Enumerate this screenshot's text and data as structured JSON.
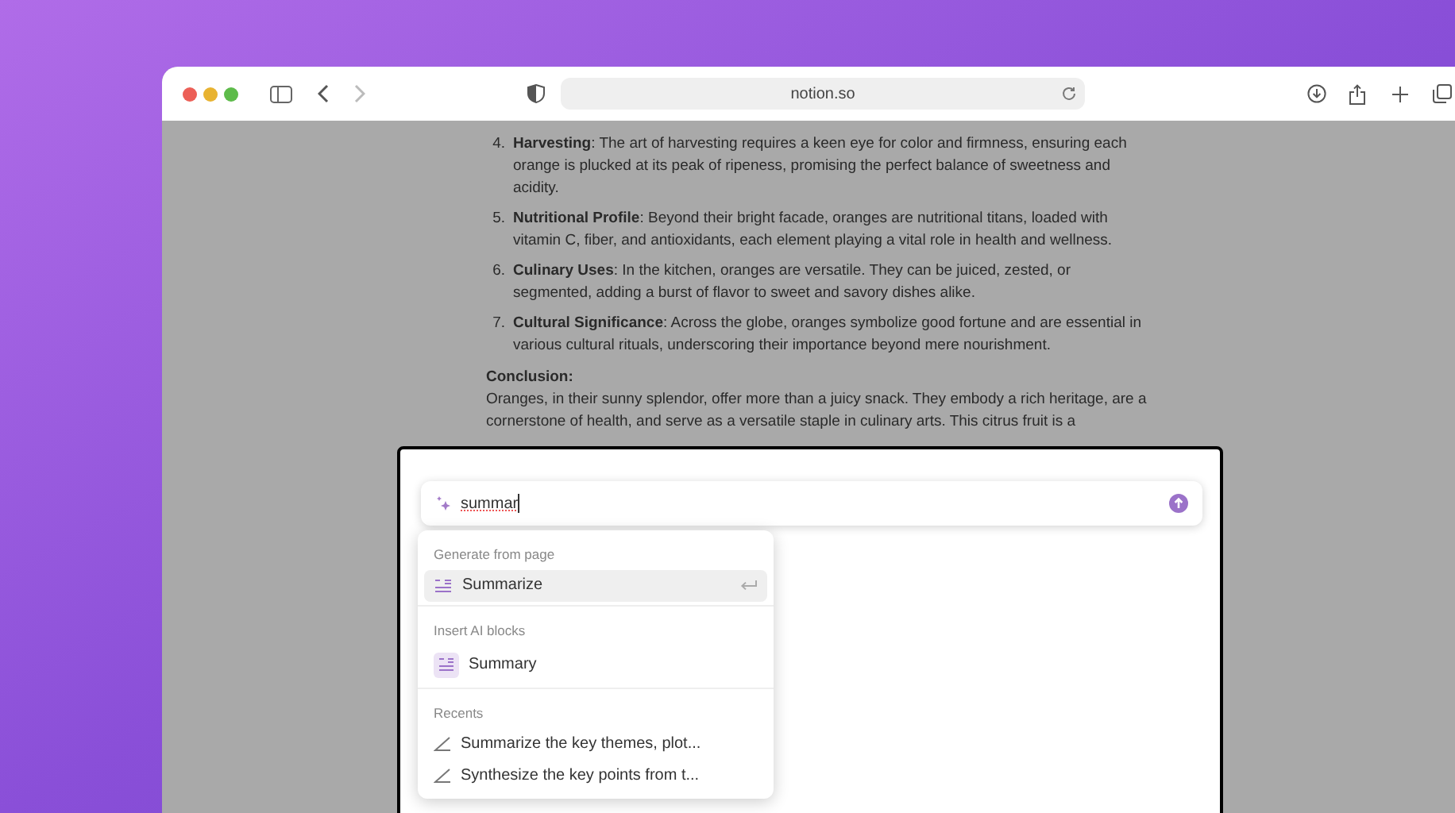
{
  "browser": {
    "url": "notion.so"
  },
  "document": {
    "list_items": [
      {
        "number": "4.",
        "text": "**Harvesting**: The art of harvesting requires a keen eye for color and firmness, ensuring each orange is plucked at its peak of ripeness, promising the perfect balance of sweetness and acidity."
      },
      {
        "number": "5.",
        "text": "**Nutritional Profile**: Beyond their bright facade, oranges are nutritional titans, loaded with vitamin C, fiber, and antioxidants, each element playing a vital role in health and wellness."
      },
      {
        "number": "6.",
        "text": "**Culinary Uses**: In the kitchen, oranges are versatile. They can be juiced, zested, or segmented, adding a burst of flavor to sweet and savory dishes alike."
      },
      {
        "number": "7.",
        "text": "**Cultural Significance**: Across the globe, oranges symbolize good fortune and are essential in various cultural rituals, underscoring their importance beyond mere nourishment."
      }
    ],
    "heading": "Conclusion:",
    "paragraph": "Oranges, in their sunny splendor, offer more than a juicy snack. They embody a rich heritage, are a cornerstone of health, and serve as a versatile staple in culinary arts. This citrus fruit is a"
  },
  "ai_prompt": {
    "value": "summar"
  },
  "menu": {
    "sections": [
      {
        "title": "Generate from page",
        "items": [
          {
            "kind": "action",
            "label": "Summarize",
            "selected": true
          }
        ]
      },
      {
        "title": "Insert AI blocks",
        "items": [
          {
            "kind": "block",
            "label": "Summary",
            "selected": false
          }
        ]
      },
      {
        "title": "Recents",
        "items": [
          {
            "kind": "recent",
            "label": "Summarize the key themes, plot...",
            "selected": false
          },
          {
            "kind": "recent",
            "label": "Synthesize the key points from t...",
            "selected": false
          }
        ]
      }
    ]
  }
}
